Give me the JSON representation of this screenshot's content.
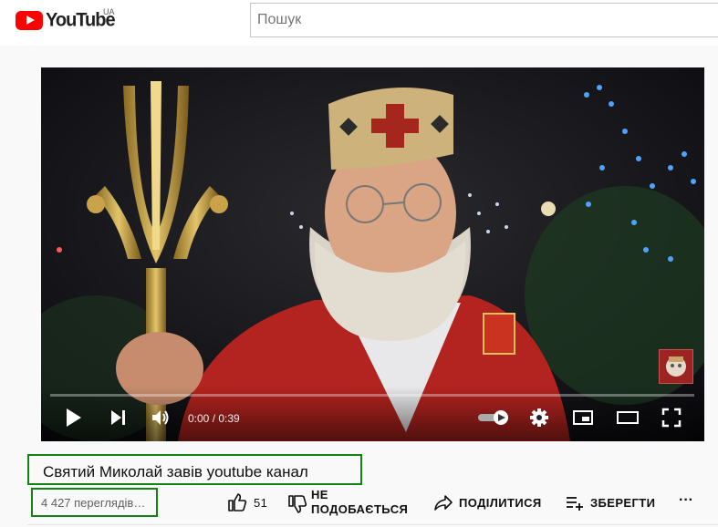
{
  "header": {
    "logo_text": "YouTube",
    "region": "UA",
    "search_placeholder": "Пошук"
  },
  "player": {
    "time": "0:00 / 0:39",
    "progress": 0
  },
  "video": {
    "title": "Святий Миколай завів youtube канал",
    "views": "4 427 переглядів…"
  },
  "actions": {
    "like_count": "51",
    "dislike_line1": "НЕ",
    "dislike_line2": "ПОДОБАЄТЬСЯ",
    "share": "ПОДІЛИТИСЯ",
    "save": "ЗБЕРЕГТИ",
    "more": "···"
  },
  "colors": {
    "brand_red": "#ff0000",
    "annotation_green": "#128312"
  }
}
